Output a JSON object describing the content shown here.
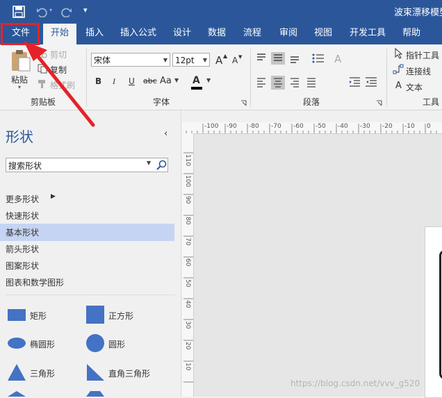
{
  "title_bar": {
    "window_title": "波束漂移模型",
    "quick_access": [
      "save-icon",
      "undo-icon",
      "redo-icon",
      "customize-icon"
    ]
  },
  "tabs": [
    {
      "label": "文件",
      "active": false
    },
    {
      "label": "开始",
      "active": true
    },
    {
      "label": "插入",
      "active": false
    },
    {
      "label": "插入公式",
      "active": false
    },
    {
      "label": "设计",
      "active": false
    },
    {
      "label": "数据",
      "active": false
    },
    {
      "label": "流程",
      "active": false
    },
    {
      "label": "审阅",
      "active": false
    },
    {
      "label": "视图",
      "active": false
    },
    {
      "label": "开发工具",
      "active": false
    },
    {
      "label": "帮助",
      "active": false
    }
  ],
  "clipboard": {
    "paste_label": "粘贴",
    "cut_label": "剪切",
    "copy_label": "复制",
    "format_painter_label": "格式刷",
    "group_label": "剪贴板"
  },
  "font": {
    "font_name": "宋体",
    "font_size": "12pt",
    "bold": "B",
    "italic": "I",
    "underline": "U",
    "strike": "abc",
    "case": "Aa",
    "color_a": "A",
    "grow": "A",
    "shrink": "A",
    "group_label": "字体"
  },
  "paragraph": {
    "group_label": "段落"
  },
  "tools": {
    "pointer_label": "指针工具",
    "connector_label": "连接线",
    "text_label": "文本",
    "text_icon": "A",
    "group_label": "工具"
  },
  "shapes_panel": {
    "title": "形状",
    "search_placeholder": "搜索形状",
    "menu": [
      {
        "label": "更多形状",
        "selected": false
      },
      {
        "label": "快速形状",
        "selected": false
      },
      {
        "label": "基本形状",
        "selected": true
      },
      {
        "label": "箭头形状",
        "selected": false
      },
      {
        "label": "图案形状",
        "selected": false
      },
      {
        "label": "图表和数学图形",
        "selected": false
      }
    ],
    "shapes": [
      {
        "label": "矩形",
        "icon": "rectangle-shape-icon"
      },
      {
        "label": "正方形",
        "icon": "square-shape-icon"
      },
      {
        "label": "椭圆形",
        "icon": "ellipse-shape-icon"
      },
      {
        "label": "圆形",
        "icon": "circle-shape-icon"
      },
      {
        "label": "三角形",
        "icon": "triangle-shape-icon"
      },
      {
        "label": "直角三角形",
        "icon": "right-triangle-shape-icon"
      }
    ]
  },
  "ruler": {
    "top_labels": [
      "-100",
      "-90",
      "-80",
      "-70",
      "-60",
      "-50",
      "-40",
      "-30",
      "-20",
      "-10",
      "0"
    ],
    "left_labels": [
      "110",
      "100",
      "90",
      "80",
      "70",
      "60",
      "50",
      "40",
      "30",
      "20",
      "10"
    ]
  },
  "watermark": "https://blog.csdn.net/vvv_g520",
  "colors": {
    "brand": "#2b579a",
    "shape_fill": "#4472c4",
    "highlight": "#c5d4f2",
    "annotation": "#e5222a"
  }
}
